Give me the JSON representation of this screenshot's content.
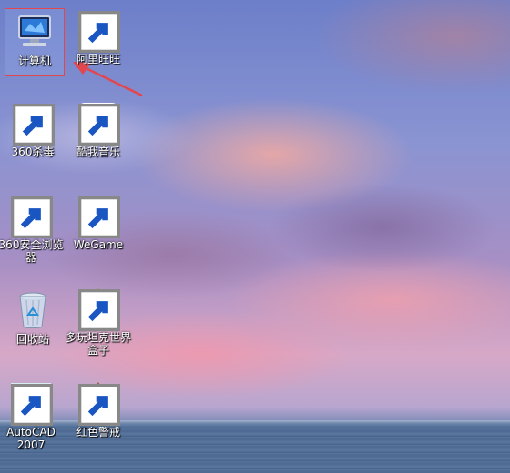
{
  "desktop": {
    "icons": [
      {
        "label": "计算机",
        "icon": "computer-icon",
        "shortcut": false
      },
      {
        "label": "阿里旺旺",
        "icon": "aliwangwang-icon",
        "shortcut": true
      },
      {
        "label": "360杀毒",
        "icon": "360-antivirus-icon",
        "shortcut": true
      },
      {
        "label": "酷我音乐",
        "icon": "kuwo-music-icon",
        "shortcut": true
      },
      {
        "label": "360安全浏览器",
        "icon": "360-browser-icon",
        "shortcut": true
      },
      {
        "label": "WeGame",
        "icon": "wegame-icon",
        "shortcut": true
      },
      {
        "label": "回收站",
        "icon": "recycle-bin-icon",
        "shortcut": false
      },
      {
        "label": "多玩坦克世界盒子",
        "icon": "tank-world-box-icon",
        "shortcut": true
      },
      {
        "label": "AutoCAD 2007",
        "icon": "autocad-icon",
        "shortcut": true
      },
      {
        "label": "红色警戒",
        "icon": "red-alert-icon",
        "shortcut": true
      }
    ],
    "selected_icon": "计算机",
    "annotation_color": "#e2474f"
  }
}
